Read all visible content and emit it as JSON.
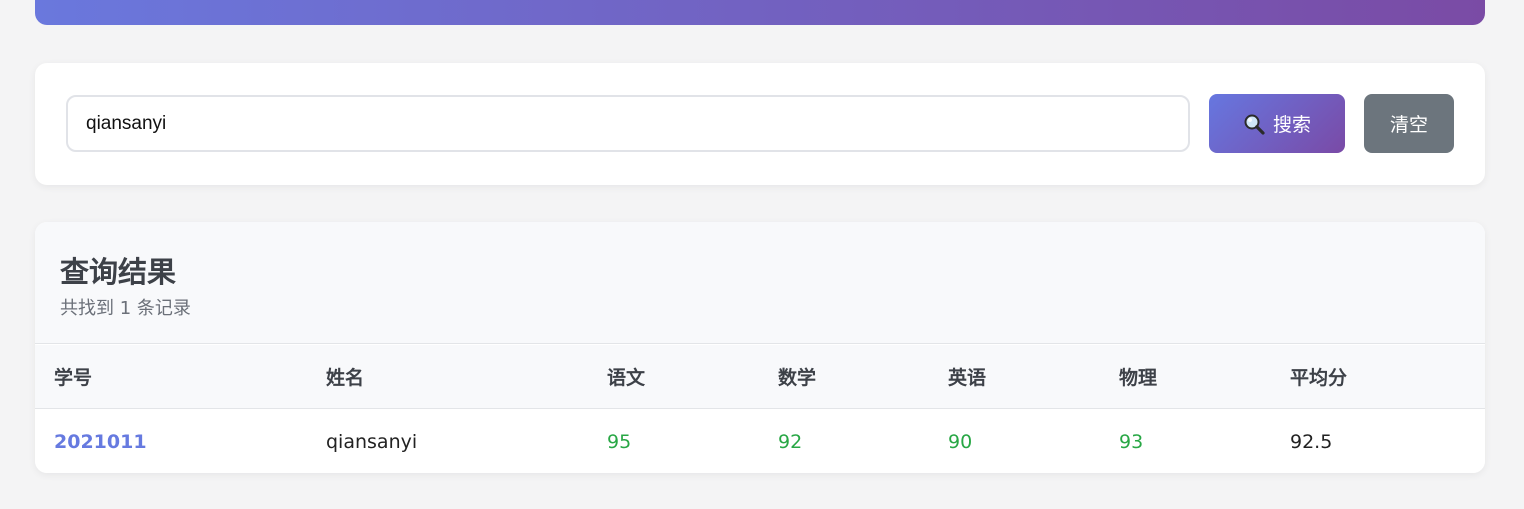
{
  "search": {
    "value": "qiansanyi",
    "search_label": "搜索",
    "clear_label": "清空"
  },
  "results": {
    "title": "查询结果",
    "subtitle": "共找到 1 条记录",
    "columns": [
      "学号",
      "姓名",
      "语文",
      "数学",
      "英语",
      "物理",
      "平均分"
    ],
    "rows": [
      {
        "id": "2021011",
        "name": "qiansanyi",
        "chinese": "95",
        "math": "92",
        "english": "90",
        "physics": "93",
        "average": "92.5"
      }
    ]
  },
  "colors": {
    "accent_start": "#6677e0",
    "accent_end": "#7a4aa6",
    "clear_button": "#6c757d",
    "score_green": "#28a745",
    "id_link": "#667ae0"
  },
  "icons": {
    "search": "magnifier-icon"
  }
}
